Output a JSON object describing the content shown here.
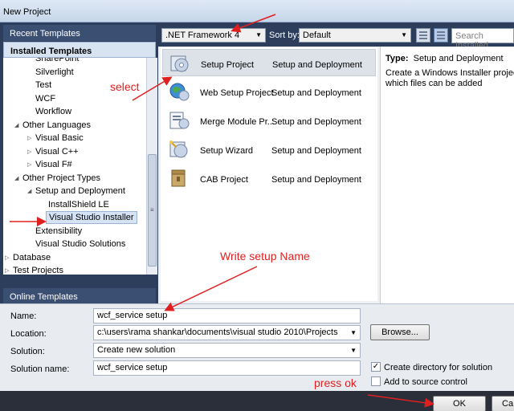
{
  "window": {
    "title": "New Project"
  },
  "left_panel": {
    "recent_templates": "Recent Templates",
    "installed_templates": "Installed Templates",
    "online_templates": "Online Templates",
    "tree": [
      {
        "label": "SharePoint",
        "level": 2
      },
      {
        "label": "Silverlight",
        "level": 2
      },
      {
        "label": "Test",
        "level": 2
      },
      {
        "label": "WCF",
        "level": 2
      },
      {
        "label": "Workflow",
        "level": 2
      },
      {
        "label": "Other Languages",
        "level": 1,
        "expanded": true
      },
      {
        "label": "Visual Basic",
        "level": 2,
        "expanded": false
      },
      {
        "label": "Visual C++",
        "level": 2,
        "expanded": false
      },
      {
        "label": "Visual F#",
        "level": 2,
        "expanded": false
      },
      {
        "label": "Other Project Types",
        "level": 1,
        "expanded": true
      },
      {
        "label": "Setup and Deployment",
        "level": 2,
        "expanded": true
      },
      {
        "label": "InstallShield LE",
        "level": 3
      },
      {
        "label": "Visual Studio Installer",
        "level": 3,
        "selected": true
      },
      {
        "label": "Extensibility",
        "level": 2
      },
      {
        "label": "Visual Studio Solutions",
        "level": 2
      },
      {
        "label": "Database",
        "level": 0,
        "expanded": false
      },
      {
        "label": "Test Projects",
        "level": 0,
        "expanded": false
      }
    ]
  },
  "toolbar": {
    "framework": ".NET Framework 4",
    "sort_label": "Sort by:",
    "sort_value": "Default",
    "search_placeholder": "Search Installed"
  },
  "templates": [
    {
      "name": "Setup Project",
      "category": "Setup and Deployment",
      "icon": "setup-project-icon",
      "selected": true
    },
    {
      "name": "Web Setup Project",
      "category": "Setup and Deployment",
      "icon": "web-setup-icon"
    },
    {
      "name": "Merge Module Pr...",
      "category": "Setup and Deployment",
      "icon": "merge-module-icon"
    },
    {
      "name": "Setup Wizard",
      "category": "Setup and Deployment",
      "icon": "setup-wizard-icon"
    },
    {
      "name": "CAB Project",
      "category": "Setup and Deployment",
      "icon": "cab-project-icon"
    }
  ],
  "details": {
    "type_label": "Type:",
    "type_value": "Setup and Deployment",
    "description_line1": "Create a Windows Installer project t",
    "description_line2": "which files can be added"
  },
  "form": {
    "name_label": "Name:",
    "name_value": "wcf_service setup",
    "location_label": "Location:",
    "location_value": "c:\\users\\rama shankar\\documents\\visual studio 2010\\Projects",
    "solution_label": "Solution:",
    "solution_value": "Create new solution",
    "solution_name_label": "Solution name:",
    "solution_name_value": "wcf_service setup",
    "browse_button": "Browse...",
    "create_directory_label": "Create directory for solution",
    "create_directory_checked": true,
    "add_source_control_label": "Add to source control",
    "add_source_control_checked": false,
    "ok_button": "OK",
    "cancel_button": "Ca"
  },
  "annotations": {
    "select": "select",
    "write_name": "Write setup Name",
    "press_ok": "press ok"
  },
  "colors": {
    "annotation": "#e02020",
    "panel_dark": "#2d3e5c",
    "selection": "#d5e3f5"
  }
}
